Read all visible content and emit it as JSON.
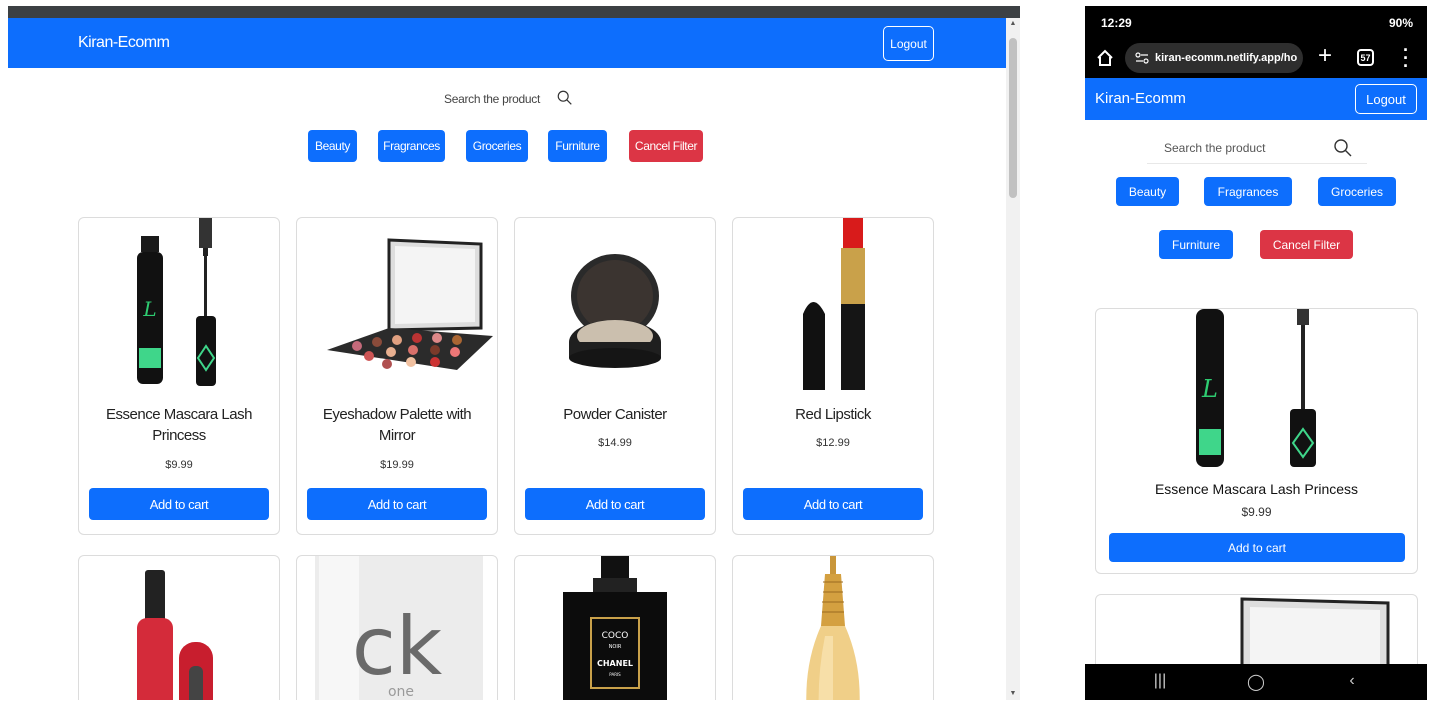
{
  "desktop": {
    "brand": "Kiran-Ecomm",
    "logout": "Logout",
    "search_placeholder": "Search the product",
    "filters": [
      "Beauty",
      "Fragrances",
      "Groceries",
      "Furniture",
      "Cancel Filter"
    ],
    "products": [
      {
        "title": "Essence Mascara Lash Princess",
        "price": "$9.99",
        "button": "Add to cart",
        "icon": "mascara-image"
      },
      {
        "title": "Eyeshadow Palette with Mirror",
        "price": "$19.99",
        "button": "Add to cart",
        "icon": "eyeshadow-palette-image"
      },
      {
        "title": "Powder Canister",
        "price": "$14.99",
        "button": "Add to cart",
        "icon": "powder-canister-image"
      },
      {
        "title": "Red Lipstick",
        "price": "$12.99",
        "button": "Add to cart",
        "icon": "red-lipstick-image"
      }
    ],
    "second_row_images": [
      "red-nail-polish-image",
      "ck-one-bottle-image",
      "chanel-coco-perfume-image",
      "dior-perfume-image"
    ],
    "ck_text": "ck",
    "ck_sub": "one",
    "coco_label": "COCO",
    "coco_noir": "NOIR",
    "chanel_label": "CHANEL",
    "chanel_paris": "PARIS"
  },
  "phone": {
    "status_time": "12:29",
    "status_battery": "90%",
    "url": "kiran-ecomm.netlify.app/ho",
    "tab_count": "57",
    "brand": "Kiran-Ecomm",
    "logout": "Logout",
    "search_placeholder": "Search the product",
    "filters": [
      "Beauty",
      "Fragrances",
      "Groceries",
      "Furniture",
      "Cancel Filter"
    ],
    "product": {
      "title": "Essence Mascara Lash Princess",
      "price": "$9.99",
      "button": "Add to cart"
    }
  },
  "colors": {
    "primary": "#0d6efd",
    "danger": "#dc3545",
    "statusbar": "#000000"
  }
}
